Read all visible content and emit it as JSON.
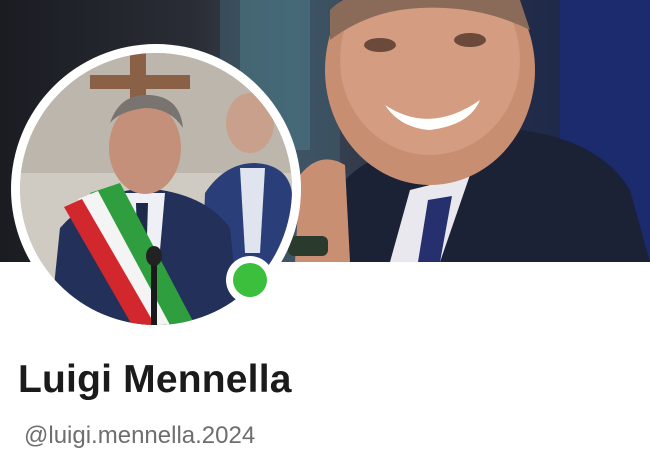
{
  "profile": {
    "name": "Luigi Mennella",
    "handle": "@luigi.mennella.2024",
    "online": true,
    "online_color": "#3bbf3d"
  },
  "icons": {
    "status": "online-dot-icon"
  }
}
